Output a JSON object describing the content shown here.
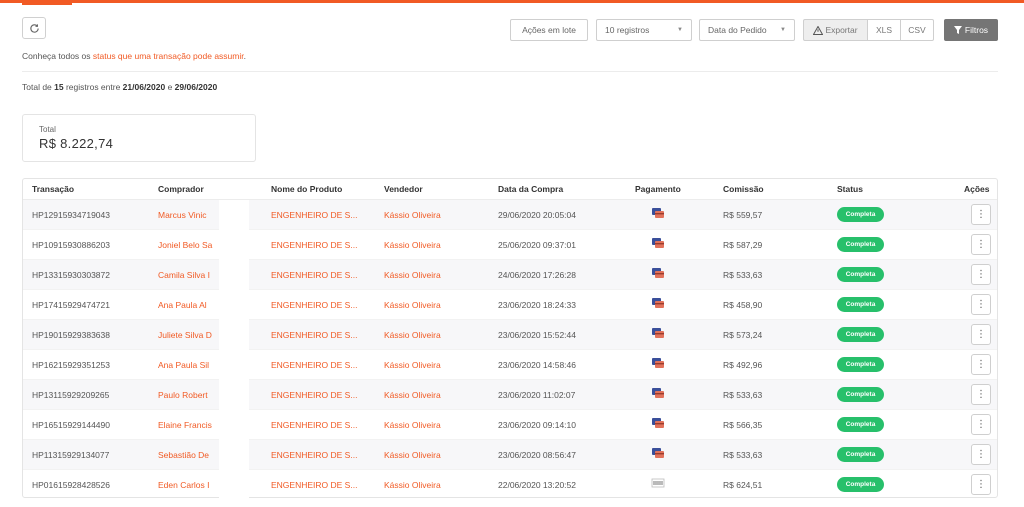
{
  "toolbar": {
    "refresh_icon": "refresh-icon",
    "acoes_label": "Ações em lote",
    "registros_value": "10 registros",
    "data_value": "Data do Pedido",
    "export_label": "Exportar",
    "xls_label": "XLS",
    "csv_label": "CSV",
    "filtros_label": "Filtros"
  },
  "status_info": {
    "prefix": "Conheça todos os ",
    "link": "status que uma transação pode assumir",
    "suffix": "."
  },
  "total_line": {
    "prefix": "Total de ",
    "count": "15",
    "middle": " registros entre ",
    "start": "21/06/2020",
    "and": " e ",
    "end": "29/06/2020"
  },
  "total_card": {
    "label": "Total",
    "value": "R$ 8.222,74"
  },
  "table": {
    "headers": {
      "transacao": "Transação",
      "comprador": "Comprador",
      "produto": "Nome do Produto",
      "vendedor": "Vendedor",
      "data": "Data da Compra",
      "pagamento": "Pagamento",
      "comissao": "Comissão",
      "status": "Status",
      "acoes": "Ações"
    },
    "rows": [
      {
        "tx": "HP12915934719043",
        "buyer": "Marcus Vinic",
        "product": "ENGENHEIRO DE S...",
        "seller": "Kássio Oliveira",
        "date": "29/06/2020 20:05:04",
        "commission": "R$ 559,57",
        "status": "Completa"
      },
      {
        "tx": "HP10915930886203",
        "buyer": "Joniel Belo Sa",
        "product": "ENGENHEIRO DE S...",
        "seller": "Kássio Oliveira",
        "date": "25/06/2020 09:37:01",
        "commission": "R$ 587,29",
        "status": "Completa"
      },
      {
        "tx": "HP13315930303872",
        "buyer": "Camila Silva I",
        "product": "ENGENHEIRO DE S...",
        "seller": "Kássio Oliveira",
        "date": "24/06/2020 17:26:28",
        "commission": "R$ 533,63",
        "status": "Completa"
      },
      {
        "tx": "HP17415929474721",
        "buyer": "Ana Paula Al",
        "product": "ENGENHEIRO DE S...",
        "seller": "Kássio Oliveira",
        "date": "23/06/2020 18:24:33",
        "commission": "R$ 458,90",
        "status": "Completa"
      },
      {
        "tx": "HP19015929383638",
        "buyer": "Juliete Silva D",
        "product": "ENGENHEIRO DE S...",
        "seller": "Kássio Oliveira",
        "date": "23/06/2020 15:52:44",
        "commission": "R$ 573,24",
        "status": "Completa"
      },
      {
        "tx": "HP16215929351253",
        "buyer": "Ana Paula Sil",
        "product": "ENGENHEIRO DE S...",
        "seller": "Kássio Oliveira",
        "date": "23/06/2020 14:58:46",
        "commission": "R$ 492,96",
        "status": "Completa"
      },
      {
        "tx": "HP13115929209265",
        "buyer": "Paulo Robert",
        "product": "ENGENHEIRO DE S...",
        "seller": "Kássio Oliveira",
        "date": "23/06/2020 11:02:07",
        "commission": "R$ 533,63",
        "status": "Completa"
      },
      {
        "tx": "HP16515929144490",
        "buyer": "Elaine Francis",
        "product": "ENGENHEIRO DE S...",
        "seller": "Kássio Oliveira",
        "date": "23/06/2020 09:14:10",
        "commission": "R$ 566,35",
        "status": "Completa"
      },
      {
        "tx": "HP11315929134077",
        "buyer": "Sebastião De",
        "product": "ENGENHEIRO DE S...",
        "seller": "Kássio Oliveira",
        "date": "23/06/2020 08:56:47",
        "commission": "R$ 533,63",
        "status": "Completa"
      },
      {
        "tx": "HP01615928428526",
        "buyer": "Eden Carlos I",
        "product": "ENGENHEIRO DE S...",
        "seller": "Kássio Oliveira",
        "date": "22/06/2020 13:20:52",
        "commission": "R$ 624,51",
        "status": "Completa"
      }
    ]
  },
  "colors": {
    "accent": "#f15a24",
    "status_green": "#27c06b",
    "filter_button": "#757575"
  }
}
